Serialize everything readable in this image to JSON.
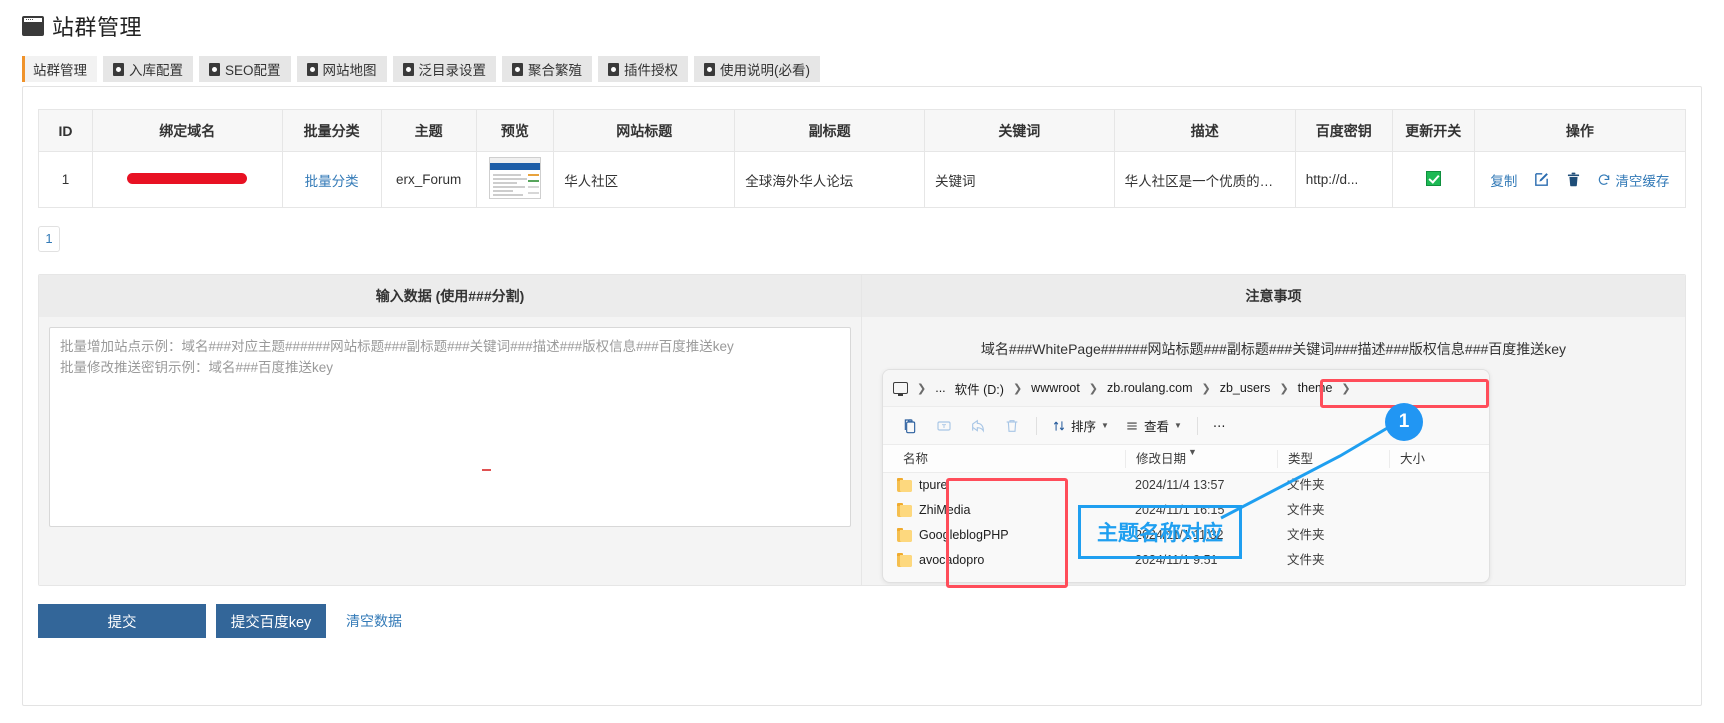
{
  "app": {
    "title": "站群管理",
    "window_icon": "window-icon"
  },
  "tabs": [
    {
      "label": "站群管理",
      "active": true,
      "icon": null
    },
    {
      "label": "入库配置",
      "active": false,
      "icon": "plugin-icon"
    },
    {
      "label": "SEO配置",
      "active": false,
      "icon": "plugin-icon"
    },
    {
      "label": "网站地图",
      "active": false,
      "icon": "plugin-icon"
    },
    {
      "label": "泛目录设置",
      "active": false,
      "icon": "plugin-icon"
    },
    {
      "label": "聚合繁殖",
      "active": false,
      "icon": "plugin-icon"
    },
    {
      "label": "插件授权",
      "active": false,
      "icon": "plugin-icon"
    },
    {
      "label": "使用说明(必看)",
      "active": false,
      "icon": "plugin-icon"
    }
  ],
  "table": {
    "columns": [
      "ID",
      "绑定域名",
      "批量分类",
      "主题",
      "预览",
      "网站标题",
      "副标题",
      "关键词",
      "描述",
      "百度密钥",
      "更新开关",
      "操作"
    ],
    "rows": [
      {
        "id": "1",
        "domain": "",
        "domain_redacted": true,
        "batch_category": "批量分类",
        "theme": "erx_Forum",
        "preview": "site-thumbnail",
        "site_title": "华人社区",
        "subtitle": "全球海外华人论坛",
        "keywords": "关键词",
        "description": "华人社区是一个优质的海外...",
        "baidu_key": "http://d...",
        "update_switch_on": true,
        "ops": {
          "copy": "复制",
          "edit_icon": "edit-icon",
          "delete_icon": "trash-icon",
          "clear_cache": "清空缓存",
          "clear_cache_icon": "refresh-icon"
        }
      }
    ]
  },
  "pagination": {
    "pages": [
      "1"
    ],
    "current": "1"
  },
  "left_panel": {
    "title": "输入数据 (使用###分割)",
    "textarea_value": "",
    "textarea_placeholder": "批量增加站点示例：域名###对应主题######网站标题###副标题###关键词###描述###版权信息###百度推送key\n批量修改推送密钥示例：域名###百度推送key"
  },
  "right_panel": {
    "title": "注意事项",
    "notice": "域名###WhitePage######网站标题###副标题###关键词###描述###版权信息###百度推送key"
  },
  "explorer": {
    "breadcrumb": [
      {
        "label": "",
        "icon": "monitor-icon"
      },
      {
        "label": "..."
      },
      {
        "label": "软件 (D:)"
      },
      {
        "label": "wwwroot"
      },
      {
        "label": "zb.roulang.com"
      },
      {
        "label": "zb_users",
        "highlighted": true
      },
      {
        "label": "theme",
        "highlighted": true
      }
    ],
    "toolbar": {
      "paste": "paste-icon",
      "rename": "rename-icon",
      "share": "share-icon",
      "delete": "trash-icon",
      "sort_label": "排序",
      "sort_icon": "sort-icon",
      "view_label": "查看",
      "view_icon": "view-icon",
      "more_icon": "more-icon"
    },
    "columns": [
      "名称",
      "修改日期",
      "类型",
      "大小"
    ],
    "rows": [
      {
        "name": "tpure",
        "date": "2024/11/4 13:57",
        "type": "文件夹",
        "size": ""
      },
      {
        "name": "ZhiMedia",
        "date": "2024/11/1 16:15",
        "type": "文件夹",
        "size": ""
      },
      {
        "name": "GoogleblogPHP",
        "date": "2024/11/1 11:32",
        "type": "文件夹",
        "size": ""
      },
      {
        "name": "avocadopro",
        "date": "2024/11/1 9:51",
        "type": "文件夹",
        "size": ""
      }
    ]
  },
  "annotations": {
    "badge_number": "1",
    "blue_label": "主题名称对应"
  },
  "footer": {
    "submit": "提交",
    "submit_baidu_key": "提交百度key",
    "clear_data": "清空数据"
  },
  "colors": {
    "accent_orange": "#f0932b",
    "link_blue": "#337ab7",
    "button_blue": "#336699",
    "annotation_red": "#ff4d5a",
    "annotation_blue": "#1f9ff0",
    "switch_green": "#1db954"
  }
}
